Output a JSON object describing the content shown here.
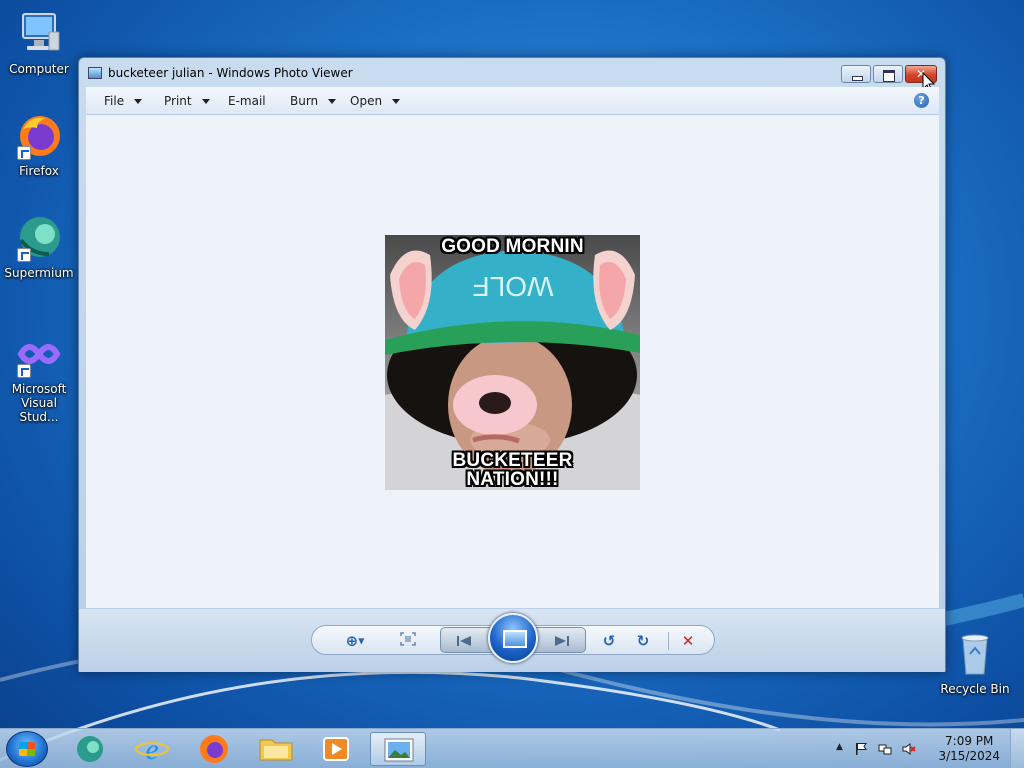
{
  "desktop": {
    "icons": [
      {
        "label": "Computer",
        "icon": "computer-icon"
      },
      {
        "label": "Firefox",
        "icon": "firefox-icon"
      },
      {
        "label": "Supermium",
        "icon": "supermium-icon"
      },
      {
        "label": "Microsoft Visual Stud...",
        "icon": "visual-studio-icon"
      },
      {
        "label": "Recycle Bin",
        "icon": "recycle-bin-icon"
      }
    ]
  },
  "window": {
    "title": "bucketeer julian - Windows Photo Viewer",
    "close_glyph": "✕",
    "menu": [
      {
        "label": "File",
        "has_dropdown": true
      },
      {
        "label": "Print",
        "has_dropdown": true
      },
      {
        "label": "E-mail",
        "has_dropdown": false
      },
      {
        "label": "Burn",
        "has_dropdown": true
      },
      {
        "label": "Open",
        "has_dropdown": true
      }
    ],
    "help_glyph": "?",
    "photo": {
      "caption_top": "GOOD MORNIN",
      "caption_bottom_line1": "BUCKETEER",
      "caption_bottom_line2": "NATION!!!",
      "hat_text": "WOLF"
    },
    "toolbar": {
      "zoom_glyph": "⊕",
      "rotate_ccw_glyph": "↺",
      "rotate_cw_glyph": "↻",
      "delete_glyph": "✕"
    }
  },
  "taskbar": {
    "clock_time": "7:09 PM",
    "clock_date": "3/15/2024",
    "tray_expand_glyph": "▲",
    "colors": {
      "accent": "#1f6fcf",
      "close": "#d2452a"
    }
  }
}
